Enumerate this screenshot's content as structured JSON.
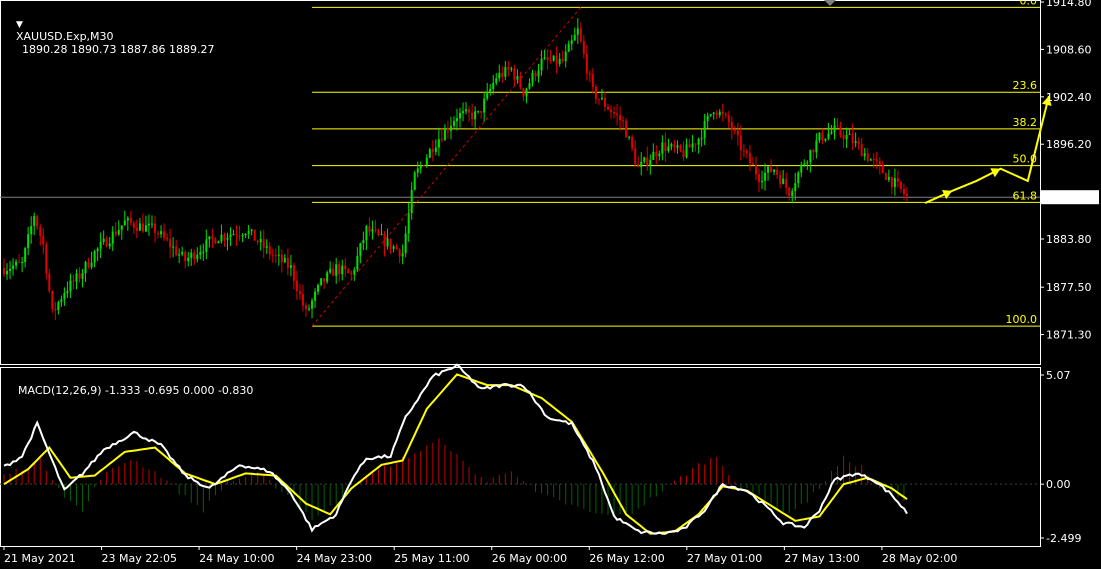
{
  "header": {
    "symbol": "XAUUSD.Exp,M30",
    "ohlc": "1890.28 1890.73 1887.86 1889.27",
    "macd_label": "MACD(12,26,9) -1.333 -0.695 0.000 -0.830"
  },
  "colors": {
    "background": "#000000",
    "bull": "#00e000",
    "bear": "#e00000",
    "fib": "#ffff00",
    "macd_main": "#ffffff",
    "macd_signal": "#ffff00",
    "hist_pos": "#c00000",
    "hist_neg": "#006400",
    "grid": "#808080"
  },
  "chart_data": [
    {
      "type": "candlestick",
      "title": "XAUUSD.Exp,M30",
      "ylim": [
        1868.5,
        1914.8
      ],
      "y_ticks": [
        "1914.80",
        "1908.60",
        "1902.40",
        "1896.20",
        "1889.27",
        "1883.80",
        "1877.50",
        "1871.30"
      ],
      "current_price": "1889.27",
      "x_ticks": [
        "21 May 2021",
        "23 May 22:05",
        "24 May 10:00",
        "24 May 23:00",
        "25 May 11:00",
        "26 May 00:00",
        "26 May 12:00",
        "27 May 01:00",
        "27 May 13:00",
        "28 May 02:00"
      ],
      "price_path": [
        {
          "i": 0,
          "p": 1880
        },
        {
          "i": 6,
          "p": 1880.5
        },
        {
          "i": 10,
          "p": 1887
        },
        {
          "i": 13,
          "p": 1883
        },
        {
          "i": 16,
          "p": 1874
        },
        {
          "i": 20,
          "p": 1877
        },
        {
          "i": 25,
          "p": 1879
        },
        {
          "i": 30,
          "p": 1882
        },
        {
          "i": 40,
          "p": 1886
        },
        {
          "i": 50,
          "p": 1885
        },
        {
          "i": 60,
          "p": 1881
        },
        {
          "i": 70,
          "p": 1884
        },
        {
          "i": 80,
          "p": 1885
        },
        {
          "i": 88,
          "p": 1882
        },
        {
          "i": 95,
          "p": 1880
        },
        {
          "i": 100,
          "p": 1874
        },
        {
          "i": 105,
          "p": 1878
        },
        {
          "i": 110,
          "p": 1880
        },
        {
          "i": 115,
          "p": 1879
        },
        {
          "i": 120,
          "p": 1885
        },
        {
          "i": 128,
          "p": 1883
        },
        {
          "i": 132,
          "p": 1882
        },
        {
          "i": 136,
          "p": 1892
        },
        {
          "i": 142,
          "p": 1896
        },
        {
          "i": 150,
          "p": 1900
        },
        {
          "i": 157,
          "p": 1900
        },
        {
          "i": 163,
          "p": 1905
        },
        {
          "i": 168,
          "p": 1906
        },
        {
          "i": 172,
          "p": 1903
        },
        {
          "i": 178,
          "p": 1907
        },
        {
          "i": 185,
          "p": 1907
        },
        {
          "i": 190,
          "p": 1911
        },
        {
          "i": 195,
          "p": 1903
        },
        {
          "i": 200,
          "p": 1901
        },
        {
          "i": 205,
          "p": 1899
        },
        {
          "i": 210,
          "p": 1893
        },
        {
          "i": 218,
          "p": 1896
        },
        {
          "i": 225,
          "p": 1895
        },
        {
          "i": 230,
          "p": 1897
        },
        {
          "i": 235,
          "p": 1901
        },
        {
          "i": 240,
          "p": 1899
        },
        {
          "i": 245,
          "p": 1895
        },
        {
          "i": 250,
          "p": 1892
        },
        {
          "i": 255,
          "p": 1893
        },
        {
          "i": 260,
          "p": 1890
        },
        {
          "i": 265,
          "p": 1894
        },
        {
          "i": 270,
          "p": 1897
        },
        {
          "i": 275,
          "p": 1898
        },
        {
          "i": 280,
          "p": 1897
        },
        {
          "i": 285,
          "p": 1895
        },
        {
          "i": 290,
          "p": 1893
        },
        {
          "i": 295,
          "p": 1891
        },
        {
          "i": 299,
          "p": 1889.3
        }
      ],
      "fibonacci": {
        "levels": [
          {
            "label": "0.0",
            "price": 1914.1
          },
          {
            "label": "23.6",
            "price": 1903.0
          },
          {
            "label": "38.2",
            "price": 1898.2
          },
          {
            "label": "50.0",
            "price": 1893.4
          },
          {
            "label": "61.8",
            "price": 1888.6
          },
          {
            "label": "100.0",
            "price": 1872.4
          }
        ]
      },
      "forecast_path": [
        1888.5,
        1890.1,
        1891.4,
        1893.0,
        1891.4,
        1902.5
      ]
    },
    {
      "type": "line",
      "title": "MACD(12,26,9)",
      "ylim": [
        -2.499,
        5.07
      ],
      "y_ticks": [
        "5.07",
        "0.00",
        "-2.499"
      ],
      "values": {
        "main": -1.333,
        "signal": -0.695,
        "level": 0.0,
        "last": -0.83
      },
      "macd_main_path": [
        {
          "i": 0,
          "p": 0.8
        },
        {
          "i": 6,
          "p": 1.3
        },
        {
          "i": 11,
          "p": 2.8
        },
        {
          "i": 20,
          "p": -0.3
        },
        {
          "i": 26,
          "p": 0.5
        },
        {
          "i": 33,
          "p": 1.6
        },
        {
          "i": 43,
          "p": 2.4
        },
        {
          "i": 52,
          "p": 1.8
        },
        {
          "i": 60,
          "p": 0.4
        },
        {
          "i": 68,
          "p": -0.2
        },
        {
          "i": 78,
          "p": 0.9
        },
        {
          "i": 88,
          "p": 0.6
        },
        {
          "i": 95,
          "p": -0.4
        },
        {
          "i": 102,
          "p": -2.1
        },
        {
          "i": 110,
          "p": -1.4
        },
        {
          "i": 115,
          "p": 0.2
        },
        {
          "i": 120,
          "p": 1.2
        },
        {
          "i": 128,
          "p": 1.3
        },
        {
          "i": 133,
          "p": 3.1
        },
        {
          "i": 142,
          "p": 5.0
        },
        {
          "i": 150,
          "p": 5.5
        },
        {
          "i": 158,
          "p": 4.4
        },
        {
          "i": 165,
          "p": 4.6
        },
        {
          "i": 172,
          "p": 4.6
        },
        {
          "i": 180,
          "p": 3.1
        },
        {
          "i": 188,
          "p": 2.8
        },
        {
          "i": 196,
          "p": 0.8
        },
        {
          "i": 202,
          "p": -1.5
        },
        {
          "i": 210,
          "p": -2.2
        },
        {
          "i": 218,
          "p": -2.3
        },
        {
          "i": 225,
          "p": -2.1
        },
        {
          "i": 232,
          "p": -1.2
        },
        {
          "i": 238,
          "p": 0.0
        },
        {
          "i": 246,
          "p": -0.3
        },
        {
          "i": 252,
          "p": -1.0
        },
        {
          "i": 258,
          "p": -1.8
        },
        {
          "i": 265,
          "p": -2.0
        },
        {
          "i": 270,
          "p": -1.2
        },
        {
          "i": 275,
          "p": 0.2
        },
        {
          "i": 282,
          "p": 0.5
        },
        {
          "i": 288,
          "p": 0.2
        },
        {
          "i": 294,
          "p": -0.5
        },
        {
          "i": 299,
          "p": -1.333
        }
      ],
      "macd_signal_path": [
        {
          "i": 0,
          "p": 0.0
        },
        {
          "i": 8,
          "p": 0.7
        },
        {
          "i": 15,
          "p": 1.7
        },
        {
          "i": 22,
          "p": 0.3
        },
        {
          "i": 30,
          "p": 0.4
        },
        {
          "i": 40,
          "p": 1.5
        },
        {
          "i": 50,
          "p": 1.7
        },
        {
          "i": 60,
          "p": 0.5
        },
        {
          "i": 70,
          "p": 0.0
        },
        {
          "i": 80,
          "p": 0.5
        },
        {
          "i": 90,
          "p": 0.4
        },
        {
          "i": 100,
          "p": -0.9
        },
        {
          "i": 108,
          "p": -1.4
        },
        {
          "i": 115,
          "p": -0.2
        },
        {
          "i": 125,
          "p": 0.9
        },
        {
          "i": 132,
          "p": 1.1
        },
        {
          "i": 140,
          "p": 3.5
        },
        {
          "i": 150,
          "p": 5.1
        },
        {
          "i": 160,
          "p": 4.6
        },
        {
          "i": 168,
          "p": 4.6
        },
        {
          "i": 178,
          "p": 4.0
        },
        {
          "i": 188,
          "p": 2.9
        },
        {
          "i": 198,
          "p": 0.6
        },
        {
          "i": 206,
          "p": -1.4
        },
        {
          "i": 214,
          "p": -2.3
        },
        {
          "i": 222,
          "p": -2.2
        },
        {
          "i": 230,
          "p": -1.4
        },
        {
          "i": 238,
          "p": -0.1
        },
        {
          "i": 246,
          "p": -0.3
        },
        {
          "i": 254,
          "p": -1.0
        },
        {
          "i": 262,
          "p": -1.7
        },
        {
          "i": 270,
          "p": -1.5
        },
        {
          "i": 278,
          "p": 0.0
        },
        {
          "i": 286,
          "p": 0.3
        },
        {
          "i": 294,
          "p": -0.2
        },
        {
          "i": 299,
          "p": -0.695
        }
      ],
      "histogram_path": [
        {
          "i": 0,
          "p": 0.4
        },
        {
          "i": 12,
          "p": 1.1
        },
        {
          "i": 20,
          "p": -0.5
        },
        {
          "i": 26,
          "p": -1.3
        },
        {
          "i": 32,
          "p": 0.3
        },
        {
          "i": 42,
          "p": 1.2
        },
        {
          "i": 52,
          "p": 0.4
        },
        {
          "i": 60,
          "p": -0.6
        },
        {
          "i": 66,
          "p": -1.2
        },
        {
          "i": 74,
          "p": 0.1
        },
        {
          "i": 84,
          "p": 0.5
        },
        {
          "i": 94,
          "p": -0.5
        },
        {
          "i": 102,
          "p": -1.6
        },
        {
          "i": 110,
          "p": -0.9
        },
        {
          "i": 116,
          "p": 0.0
        },
        {
          "i": 126,
          "p": 0.8
        },
        {
          "i": 134,
          "p": 1.3
        },
        {
          "i": 145,
          "p": 2.1
        },
        {
          "i": 152,
          "p": 1.0
        },
        {
          "i": 160,
          "p": 0.1
        },
        {
          "i": 168,
          "p": 0.7
        },
        {
          "i": 176,
          "p": -0.4
        },
        {
          "i": 186,
          "p": -0.9
        },
        {
          "i": 196,
          "p": -1.4
        },
        {
          "i": 206,
          "p": -1.5
        },
        {
          "i": 214,
          "p": -0.7
        },
        {
          "i": 222,
          "p": 0.1
        },
        {
          "i": 230,
          "p": 0.9
        },
        {
          "i": 236,
          "p": 1.3
        },
        {
          "i": 244,
          "p": -0.2
        },
        {
          "i": 252,
          "p": -0.6
        },
        {
          "i": 258,
          "p": -1.4
        },
        {
          "i": 266,
          "p": -0.8
        },
        {
          "i": 272,
          "p": 0.2
        },
        {
          "i": 278,
          "p": 1.2
        },
        {
          "i": 284,
          "p": 0.8
        },
        {
          "i": 290,
          "p": -0.3
        },
        {
          "i": 299,
          "p": -0.8
        }
      ]
    }
  ]
}
